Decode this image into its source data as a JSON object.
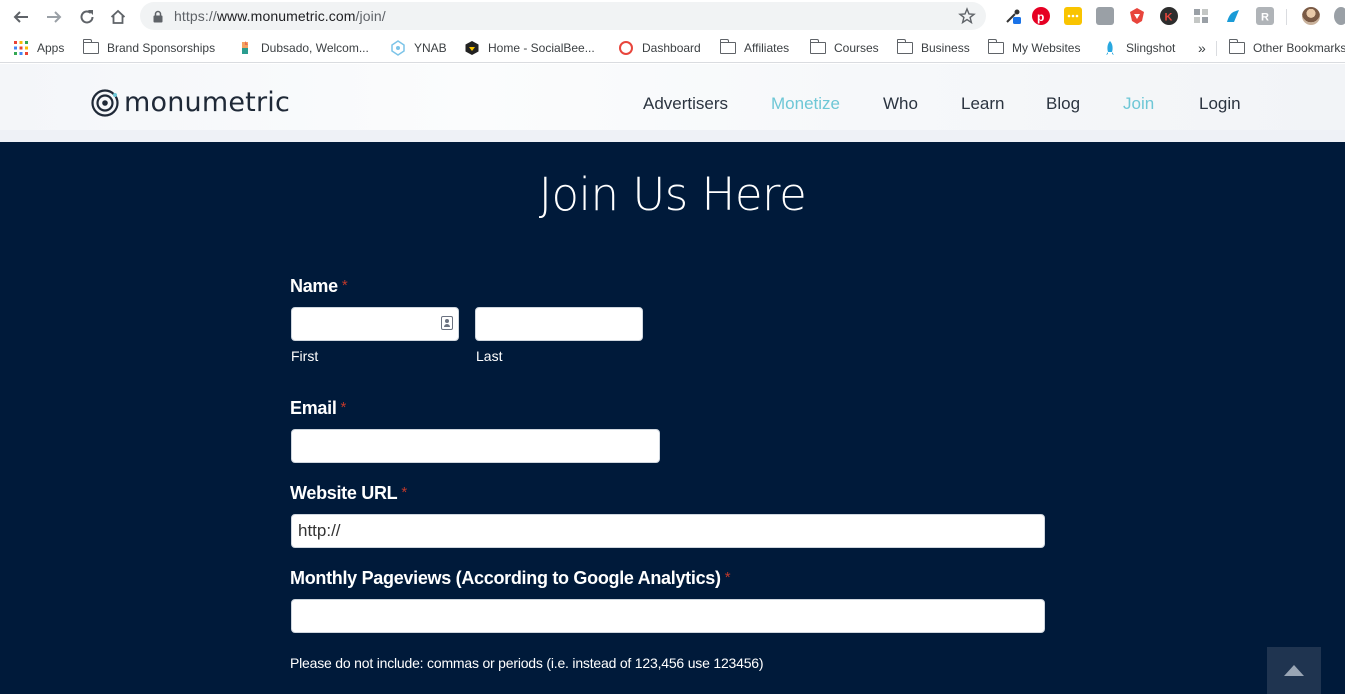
{
  "browser": {
    "url_prefix": "https://",
    "url_host": "www.monumetric.com",
    "url_path": "/join/",
    "bookmarks": [
      {
        "label": "Apps",
        "icon": "apps-grid-icon"
      },
      {
        "label": "Brand Sponsorships",
        "icon": "folder-icon"
      },
      {
        "label": "Dubsado, Welcom...",
        "icon": "dubsado-icon"
      },
      {
        "label": "YNAB",
        "icon": "ynab-icon"
      },
      {
        "label": "Home - SocialBee...",
        "icon": "socialbee-icon"
      },
      {
        "label": "Dashboard",
        "icon": "dashboard-icon"
      },
      {
        "label": "Affiliates",
        "icon": "folder-icon"
      },
      {
        "label": "Courses",
        "icon": "folder-icon"
      },
      {
        "label": "Business",
        "icon": "folder-icon"
      },
      {
        "label": "My Websites",
        "icon": "folder-icon"
      },
      {
        "label": "Slingshot",
        "icon": "rocket-icon"
      },
      {
        "label": "Other Bookmarks",
        "icon": "folder-icon"
      }
    ],
    "overflow": "»"
  },
  "site": {
    "logo_text": "monumetric",
    "nav": [
      {
        "label": "Advertisers",
        "active": false
      },
      {
        "label": "Monetize",
        "active": true
      },
      {
        "label": "Who",
        "active": false
      },
      {
        "label": "Learn",
        "active": false
      },
      {
        "label": "Blog",
        "active": false
      },
      {
        "label": "Join",
        "active": true
      },
      {
        "label": "Login",
        "active": false
      }
    ],
    "active_color": "#6ec7d6",
    "background_color": "#001a3a"
  },
  "form": {
    "title": "Join Us Here",
    "required_mark": "*",
    "name": {
      "label": "Name",
      "first_sublabel": "First",
      "last_sublabel": "Last",
      "first_value": "",
      "last_value": ""
    },
    "email": {
      "label": "Email",
      "value": ""
    },
    "website": {
      "label": "Website URL",
      "value": "http://"
    },
    "pageviews": {
      "label": "Monthly Pageviews (According to Google Analytics)",
      "value": "",
      "hint": "Please do not include: commas or periods (i.e. instead of 123,456 use 123456)"
    }
  }
}
